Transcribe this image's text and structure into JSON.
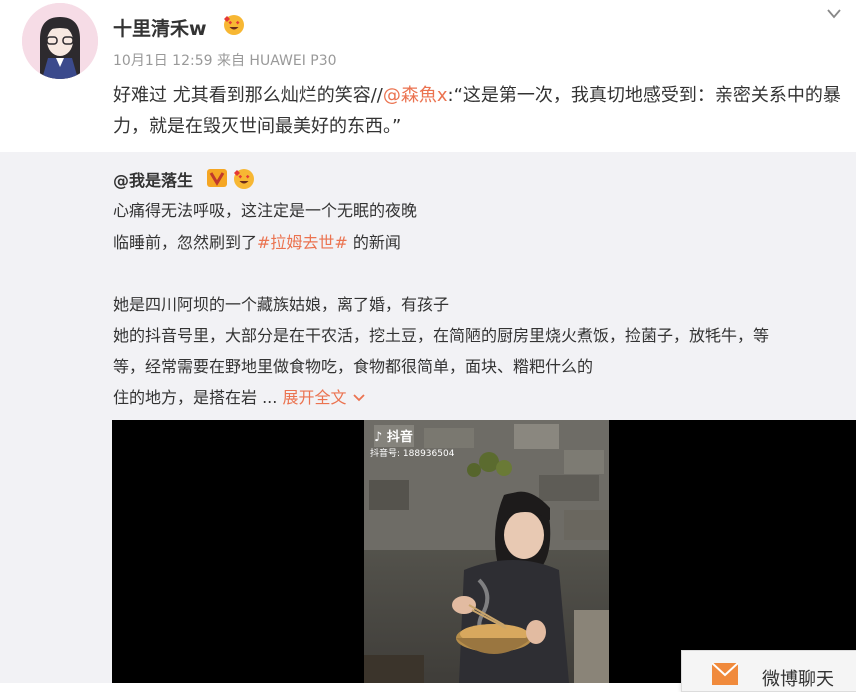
{
  "post": {
    "username": "十里清禾w",
    "meta": "10月1日 12:59 来自 HUAWEI P30",
    "text_part1": "好难过 尤其看到那么灿烂的笑容//",
    "mention": "@森魚x",
    "text_part2": ":“这是第一次，我真切地感受到：亲密关系中的暴力，就是在毁灭世间最美好的东西。”"
  },
  "repost": {
    "author": "@我是落生",
    "line1": "心痛得无法呼吸，这注定是一个无眠的夜晚",
    "line2_before": "临睡前，忽然刷到了",
    "hashtag": "#拉姆去世#",
    "line2_after": " 的新闻",
    "line3": "她是四川阿坝的一个藏族姑娘，离了婚，有孩子",
    "line4": "她的抖音号里，大部分是在干农活，挖土豆，在简陋的厨房里烧火煮饭，捡菌子，放牦牛，等",
    "line5": "等，经常需要在野地里做食物吃，食物都很简单，面块、糌粑什么的",
    "line6": "住的地方，是搭在岩 ... ",
    "expand": "展开全文",
    "video": {
      "app_name": "抖音",
      "account_id": "抖音号: 188936504"
    }
  },
  "chat": {
    "label": "微博聊天"
  },
  "colors": {
    "accent": "#eb7350",
    "repost_bg": "#f2f2f5",
    "meta_text": "#999999"
  },
  "icons": [
    "avatar",
    "heart-eyes-emoji",
    "chevron-down-icon",
    "verified-badge-icon",
    "douyin-logo-icon",
    "mail-icon"
  ]
}
